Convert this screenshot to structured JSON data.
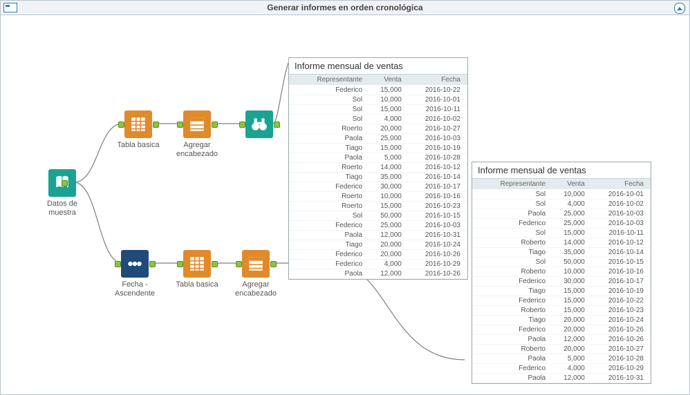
{
  "title": "Generar informes en orden cronológica",
  "nodes": {
    "source": {
      "label": "Datos de muestra"
    },
    "tabla1": {
      "label": "Tabla basica"
    },
    "header1": {
      "label": "Agregar encabezado"
    },
    "browse1": {
      "label": ""
    },
    "sort": {
      "label": "Fecha - Ascendente"
    },
    "tabla2": {
      "label": "Tabla basica"
    },
    "header2": {
      "label": "Agregar encabezado"
    },
    "browse2": {
      "label": ""
    }
  },
  "report1": {
    "caption": "Informe mensual de ventas",
    "columns": [
      "Representante",
      "Venta",
      "Fecha"
    ],
    "rows": [
      [
        "Federico",
        "15,000",
        "2016-10-22"
      ],
      [
        "Sol",
        "10,000",
        "2016-10-01"
      ],
      [
        "Sol",
        "15,000",
        "2016-10-11"
      ],
      [
        "Sol",
        "4,000",
        "2016-10-02"
      ],
      [
        "Roerto",
        "20,000",
        "2016-10-27"
      ],
      [
        "Paola",
        "25,000",
        "2016-10-03"
      ],
      [
        "Tiago",
        "15,000",
        "2016-10-19"
      ],
      [
        "Paola",
        "5,000",
        "2016-10-28"
      ],
      [
        "Roerto",
        "14,000",
        "2016-10-12"
      ],
      [
        "Tiago",
        "35,000",
        "2016-10-14"
      ],
      [
        "Federico",
        "30,000",
        "2016-10-17"
      ],
      [
        "Roerto",
        "10,000",
        "2016-10-16"
      ],
      [
        "Roerto",
        "15,000",
        "2016-10-23"
      ],
      [
        "Sol",
        "50,000",
        "2016-10-15"
      ],
      [
        "Federico",
        "25,000",
        "2016-10-03"
      ],
      [
        "Paola",
        "12,000",
        "2016-10-31"
      ],
      [
        "Tiago",
        "20,000",
        "2016-10-24"
      ],
      [
        "Federico",
        "20,000",
        "2016-10-26"
      ],
      [
        "Federico",
        "4,000",
        "2016-10-29"
      ],
      [
        "Paola",
        "12,000",
        "2016-10-26"
      ]
    ]
  },
  "report2": {
    "caption": "Informe mensual de ventas",
    "columns": [
      "Representante",
      "Venta",
      "Fecha"
    ],
    "rows": [
      [
        "Sol",
        "10,000",
        "2016-10-01"
      ],
      [
        "Sol",
        "4,000",
        "2016-10-02"
      ],
      [
        "Paola",
        "25,000",
        "2016-10-03"
      ],
      [
        "Federico",
        "25,000",
        "2016-10-03"
      ],
      [
        "Sol",
        "15,000",
        "2016-10-11"
      ],
      [
        "Roberto",
        "14,000",
        "2016-10-12"
      ],
      [
        "Tiago",
        "35,000",
        "2016-10-14"
      ],
      [
        "Sol",
        "50,000",
        "2016-10-15"
      ],
      [
        "Roberto",
        "10,000",
        "2016-10-16"
      ],
      [
        "Federico",
        "30,000",
        "2016-10-17"
      ],
      [
        "Tiago",
        "15,000",
        "2016-10-19"
      ],
      [
        "Federico",
        "15,000",
        "2016-10-22"
      ],
      [
        "Roberto",
        "15,000",
        "2016-10-23"
      ],
      [
        "Tiago",
        "20,000",
        "2016-10-24"
      ],
      [
        "Federico",
        "20,000",
        "2016-10-26"
      ],
      [
        "Paola",
        "12,000",
        "2016-10-26"
      ],
      [
        "Roberto",
        "20,000",
        "2016-10-27"
      ],
      [
        "Paola",
        "5,000",
        "2016-10-28"
      ],
      [
        "Federico",
        "4,000",
        "2016-10-29"
      ],
      [
        "Paola",
        "12,000",
        "2016-10-31"
      ]
    ]
  }
}
